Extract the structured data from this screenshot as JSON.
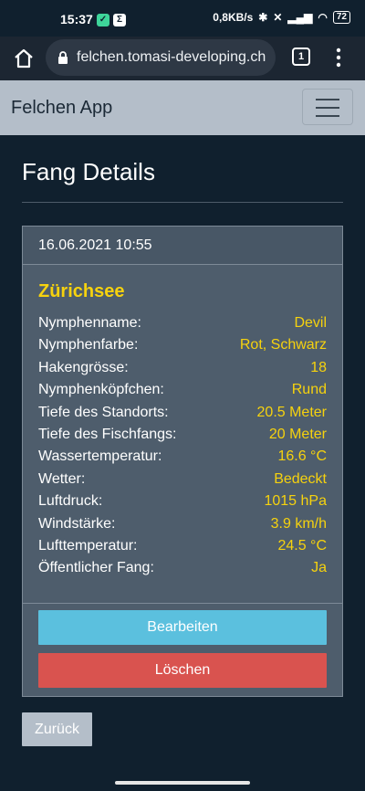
{
  "status_bar": {
    "time": "15:37",
    "app_icon_1": "shield-icon",
    "app_icon_2": "Σ",
    "network_speed": "0,8KB/s",
    "battery": "72"
  },
  "browser": {
    "url": "felchen.tomasi-developing.ch",
    "tab_count": "1"
  },
  "navbar": {
    "brand": "Felchen App"
  },
  "page": {
    "title": "Fang Details",
    "card": {
      "datetime": "16.06.2021 10:55",
      "lake": "Zürichsee",
      "details": [
        {
          "label": "Nymphenname:",
          "value": "Devil"
        },
        {
          "label": "Nymphenfarbe:",
          "value": "Rot, Schwarz"
        },
        {
          "label": "Hakengrösse:",
          "value": "18"
        },
        {
          "label": "Nymphenköpfchen:",
          "value": "Rund"
        },
        {
          "label": "Tiefe des Standorts:",
          "value": "20.5 Meter"
        },
        {
          "label": "Tiefe des Fischfangs:",
          "value": "20 Meter"
        },
        {
          "label": "Wassertemperatur:",
          "value": "16.6 °C"
        },
        {
          "label": "Wetter:",
          "value": "Bedeckt"
        },
        {
          "label": "Luftdruck:",
          "value": "1015 hPa"
        },
        {
          "label": "Windstärke:",
          "value": "3.9 km/h"
        },
        {
          "label": "Lufttemperatur:",
          "value": "24.5 °C"
        },
        {
          "label": "Öffentlicher Fang:",
          "value": "Ja"
        }
      ],
      "edit_label": "Bearbeiten",
      "delete_label": "Löschen"
    },
    "back_label": "Zurück"
  },
  "colors": {
    "page_bg": "#10202e",
    "card_bg": "#4e5d6c",
    "accent_yellow": "#f6d20e",
    "edit_btn": "#5bc0de",
    "delete_btn": "#d9534f",
    "navbar_bg": "#b4bec9"
  }
}
